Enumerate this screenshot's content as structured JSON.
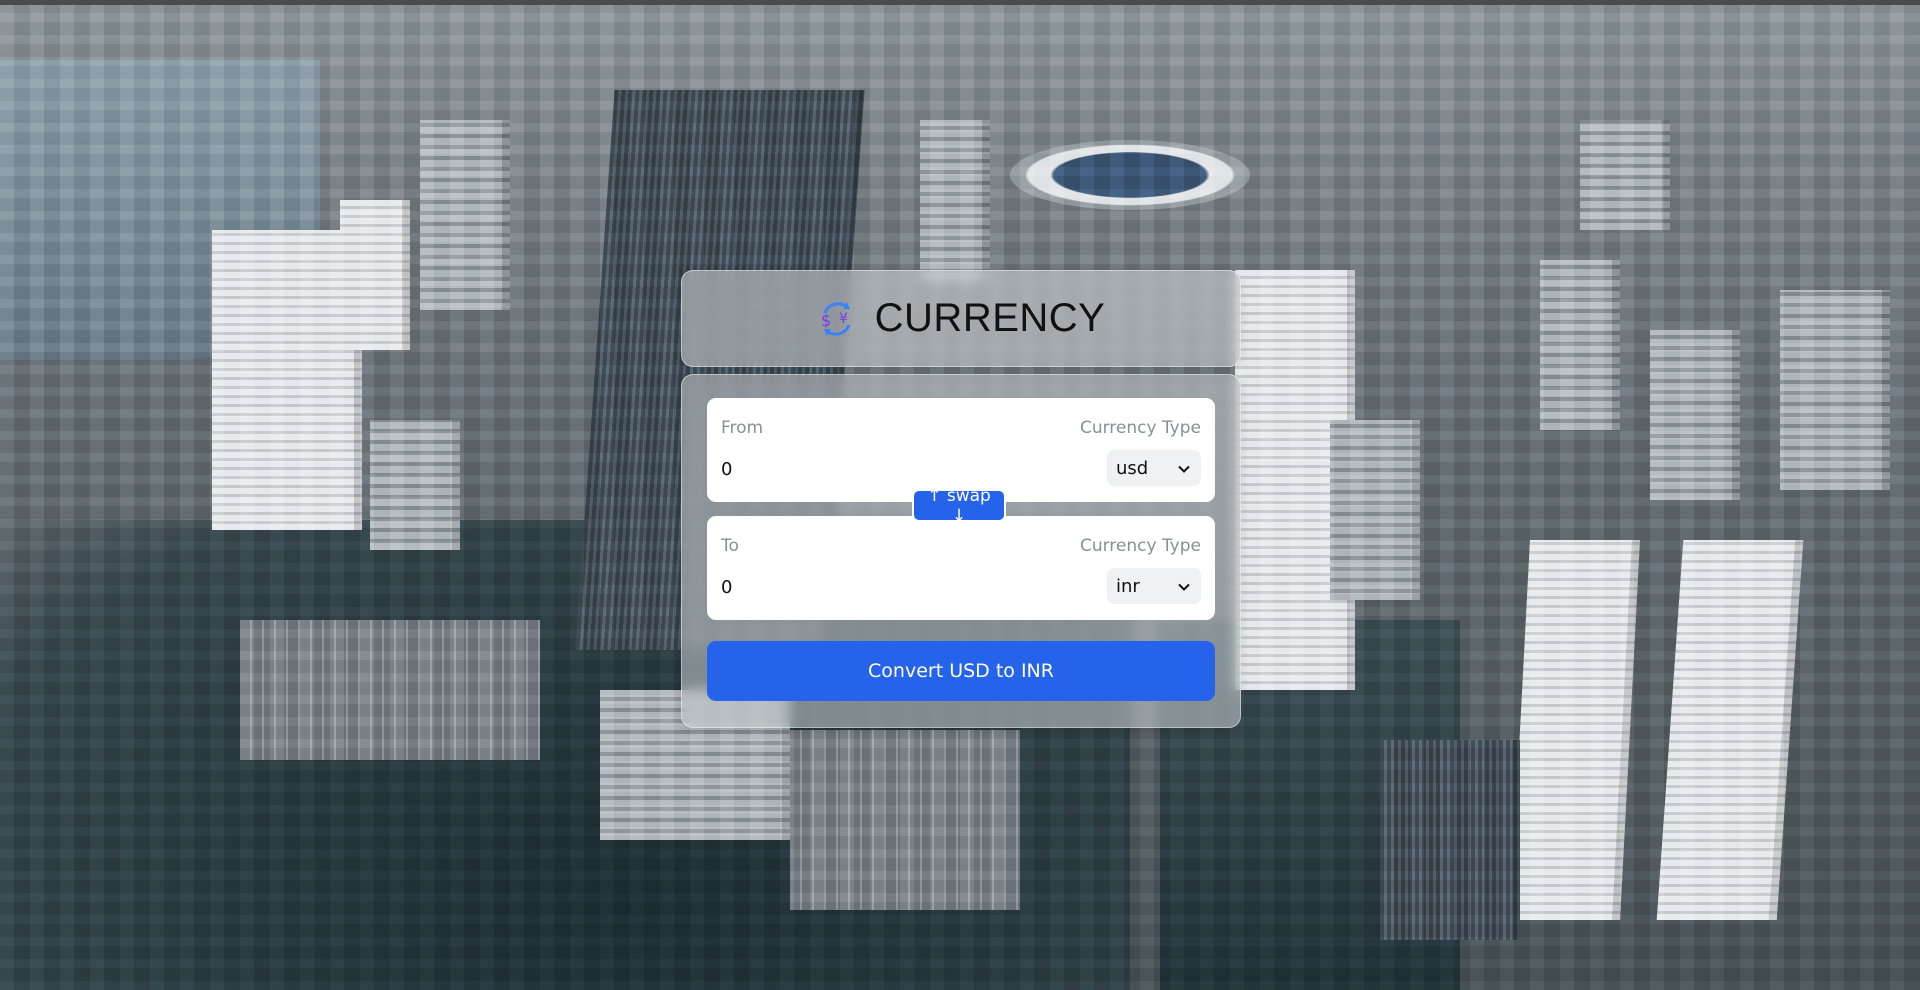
{
  "header": {
    "title": "CURRENCY",
    "logo_icon": "currency-exchange-icon"
  },
  "from": {
    "label": "From",
    "type_label": "Currency Type",
    "amount": "0",
    "currency": "usd"
  },
  "swap": {
    "label": "↑ swap ↓"
  },
  "to": {
    "label": "To",
    "type_label": "Currency Type",
    "amount": "0",
    "currency": "inr"
  },
  "convert": {
    "label": "Convert USD to INR"
  },
  "colors": {
    "accent": "#2563eb",
    "card_bg": "rgba(200,205,208,0.55)"
  }
}
